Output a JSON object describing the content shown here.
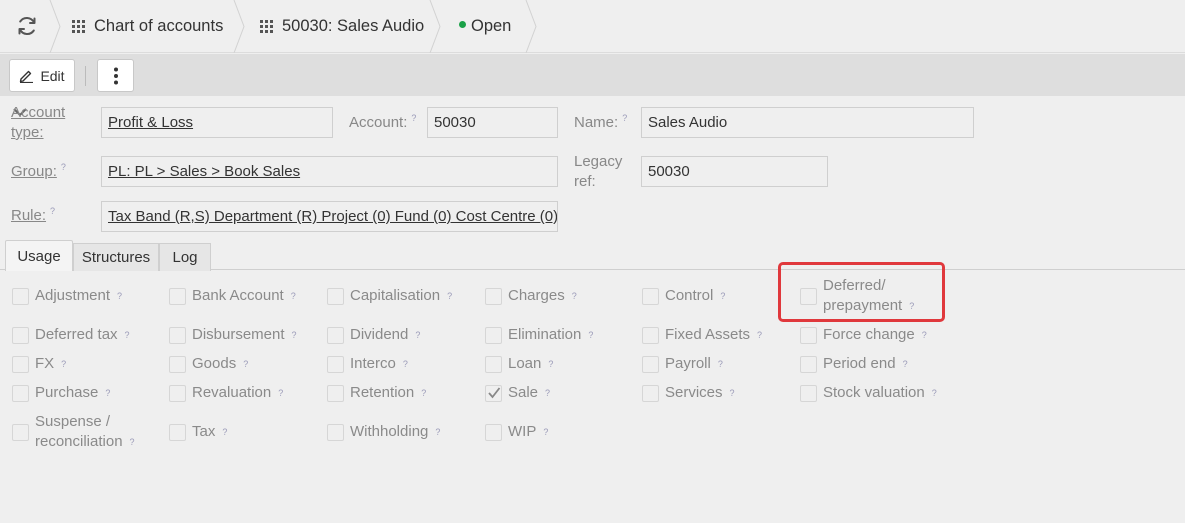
{
  "breadcrumb": {
    "items": [
      {
        "label": "Chart of accounts",
        "icon": "grid-icon"
      },
      {
        "label": "50030: Sales Audio",
        "icon": "grid-icon"
      },
      {
        "label": "Open",
        "icon": "status-dot",
        "color": "#1aa148"
      }
    ]
  },
  "toolbar": {
    "edit_label": "Edit",
    "more_icon": "more-vertical-icon"
  },
  "form": {
    "account_type": {
      "label": "Account type:",
      "value": "Profit & Loss"
    },
    "account": {
      "label": "Account:",
      "value": "50030"
    },
    "name": {
      "label": "Name:",
      "value": "Sales Audio"
    },
    "group": {
      "label": "Group:",
      "value": "PL: PL > Sales > Book Sales"
    },
    "legacy_ref": {
      "label": "Legacy ref:",
      "value": "50030"
    },
    "rule": {
      "label": "Rule:",
      "value": "Tax Band (R,S) Department (R) Project (0) Fund (0) Cost Centre (0)"
    },
    "help_mark": "?"
  },
  "tabs": [
    {
      "label": "Usage",
      "active": true
    },
    {
      "label": "Structures",
      "active": false
    },
    {
      "label": "Log",
      "active": false
    }
  ],
  "usage": [
    {
      "label": "Adjustment",
      "checked": false
    },
    {
      "label": "Bank Account",
      "checked": false
    },
    {
      "label": "Capitalisation",
      "checked": false
    },
    {
      "label": "Charges",
      "checked": false
    },
    {
      "label": "Control",
      "checked": false
    },
    {
      "label": "Deferred/ prepayment",
      "checked": false
    },
    {
      "label": "Deferred tax",
      "checked": false
    },
    {
      "label": "Disbursement",
      "checked": false
    },
    {
      "label": "Dividend",
      "checked": false
    },
    {
      "label": "Elimination",
      "checked": false
    },
    {
      "label": "Fixed Assets",
      "checked": false
    },
    {
      "label": "Force change",
      "checked": false
    },
    {
      "label": "FX",
      "checked": false
    },
    {
      "label": "Goods",
      "checked": false
    },
    {
      "label": "Interco",
      "checked": false
    },
    {
      "label": "Loan",
      "checked": false
    },
    {
      "label": "Payroll",
      "checked": false
    },
    {
      "label": "Period end",
      "checked": false
    },
    {
      "label": "Purchase",
      "checked": false
    },
    {
      "label": "Revaluation",
      "checked": false
    },
    {
      "label": "Retention",
      "checked": false
    },
    {
      "label": "Sale",
      "checked": true
    },
    {
      "label": "Services",
      "checked": false
    },
    {
      "label": "Stock valuation",
      "checked": false
    },
    {
      "label": "Suspense / reconciliation",
      "checked": false
    },
    {
      "label": "Tax",
      "checked": false
    },
    {
      "label": "Withholding",
      "checked": false
    },
    {
      "label": "WIP",
      "checked": false
    }
  ],
  "highlight": {
    "target": "Deferred/ prepayment",
    "color": "#e0383c"
  }
}
